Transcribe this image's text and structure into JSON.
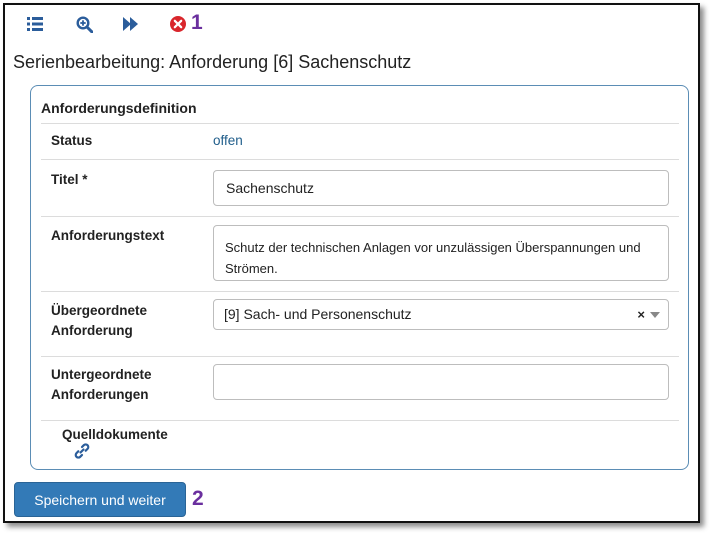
{
  "toolbar": {
    "icons": [
      "list-icon",
      "zoom-in-icon",
      "fast-forward-icon",
      "close-circle-icon"
    ],
    "marker_1": "1"
  },
  "page": {
    "title": "Serienbearbeitung: Anforderung [6] Sachenschutz"
  },
  "panel": {
    "heading": "Anforderungsdefinition",
    "status": {
      "label": "Status",
      "value": "offen"
    },
    "titel": {
      "label": "Titel *",
      "value": "Sachenschutz"
    },
    "text": {
      "label": "Anforderungstext",
      "value": "Schutz der technischen Anlagen vor unzulässigen Überspannungen und Strömen."
    },
    "parent": {
      "label_line1": "Übergeordnete",
      "label_line2": "Anforderung",
      "value": "[9] Sach- und Personenschutz",
      "clear": "×"
    },
    "children": {
      "label_line1": "Untergeordnete",
      "label_line2": "Anforderungen",
      "value": ""
    },
    "sources": {
      "label": "Quelldokumente"
    }
  },
  "footer": {
    "save_label": "Speichern und weiter",
    "marker_2": "2"
  },
  "colors": {
    "primary": "#337ab7",
    "link": "#1f5d8a",
    "marker": "#6a2f9e",
    "danger": "#d9262c"
  }
}
